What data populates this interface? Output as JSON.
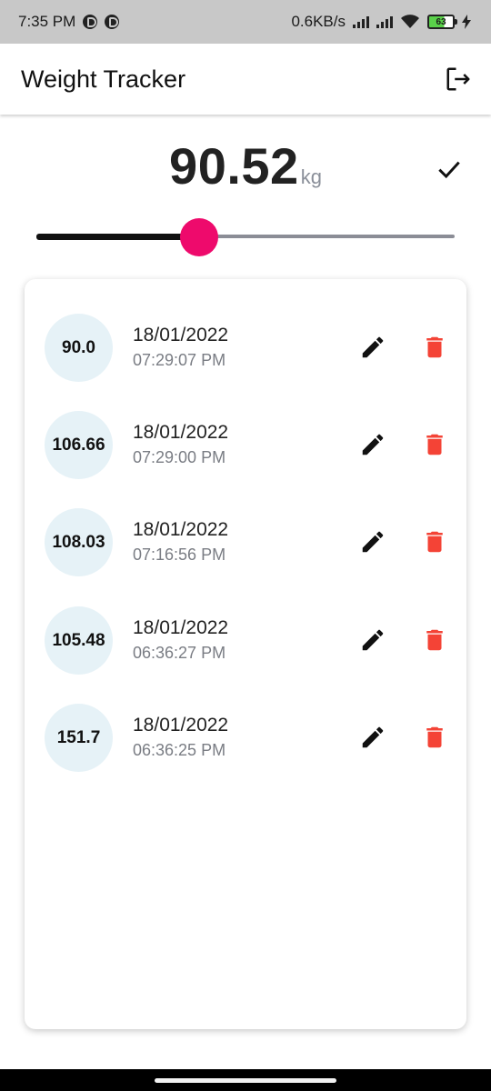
{
  "status_bar": {
    "time": "7:35 PM",
    "network_speed": "0.6KB/s",
    "battery": "63"
  },
  "app_bar": {
    "title": "Weight Tracker",
    "logout_icon": "logout-icon"
  },
  "weight": {
    "value": "90.52",
    "unit": "kg",
    "confirm_icon": "check-icon"
  },
  "slider": {
    "level": 0.39,
    "active_color": "#111111",
    "inactive_color": "#8b8d96",
    "thumb_color": "#ee0a6c"
  },
  "entries": [
    {
      "weight": "90.0",
      "date": "18/01/2022",
      "time": "07:29:07 PM"
    },
    {
      "weight": "106.66",
      "date": "18/01/2022",
      "time": "07:29:00 PM"
    },
    {
      "weight": "108.03",
      "date": "18/01/2022",
      "time": "07:16:56 PM"
    },
    {
      "weight": "105.48",
      "date": "18/01/2022",
      "time": "06:36:27 PM"
    },
    {
      "weight": "151.7",
      "date": "18/01/2022",
      "time": "06:36:25 PM"
    }
  ],
  "colors": {
    "delete": "#f44336",
    "circle_bg": "#e6f2f7"
  }
}
